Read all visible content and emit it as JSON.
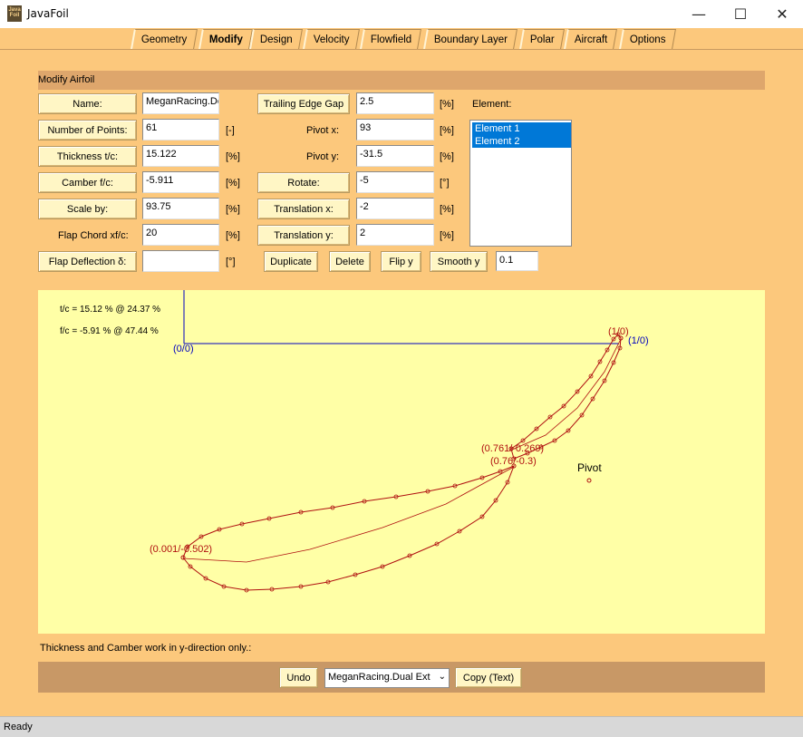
{
  "window": {
    "title": "JavaFoil",
    "icon_text": "Java Foil",
    "minimize_glyph": "—",
    "maximize_glyph": "☐",
    "close_glyph": "✕"
  },
  "tabs": [
    {
      "label": "Geometry",
      "active": false
    },
    {
      "label": "Modify",
      "active": true
    },
    {
      "label": "Design",
      "active": false
    },
    {
      "label": "Velocity",
      "active": false
    },
    {
      "label": "Flowfield",
      "active": false
    },
    {
      "label": "Boundary Layer",
      "active": false
    },
    {
      "label": "Polar",
      "active": false
    },
    {
      "label": "Aircraft",
      "active": false
    },
    {
      "label": "Options",
      "active": false
    }
  ],
  "section_title": "Modify Airfoil",
  "left_fields": {
    "name": {
      "label": "Name:",
      "value": "MeganRacing.De"
    },
    "points": {
      "label": "Number of Points:",
      "value": "61",
      "unit": "[-]"
    },
    "thickness": {
      "label": "Thickness  t/c:",
      "value": "15.122",
      "unit": "[%]"
    },
    "camber": {
      "label": "Camber  f/c:",
      "value": "-5.911",
      "unit": "[%]"
    },
    "scale": {
      "label": "Scale by:",
      "value": "93.75",
      "unit": "[%]"
    },
    "flap_chord": {
      "label": "Flap Chord    xf/c:",
      "value": "20",
      "unit": "[%]"
    },
    "flap_deflection": {
      "label": "Flap Deflection  δ:",
      "value": "",
      "unit": "[°]"
    }
  },
  "right_fields": {
    "te_gap": {
      "label": "Trailing Edge Gap",
      "value": "2.5",
      "unit": "[%]"
    },
    "pivot_x": {
      "label": "Pivot x:",
      "value": "93",
      "unit": "[%]"
    },
    "pivot_y": {
      "label": "Pivot y:",
      "value": "-31.5",
      "unit": "[%]"
    },
    "rotate": {
      "label": "Rotate:",
      "value": "-5",
      "unit": "[°]"
    },
    "translation_x": {
      "label": "Translation x:",
      "value": "-2",
      "unit": "[%]"
    },
    "translation_y": {
      "label": "Translation y:",
      "value": "2",
      "unit": "[%]"
    }
  },
  "element": {
    "label": "Element:",
    "items": [
      "Element 1",
      "Element 2"
    ]
  },
  "actions": {
    "duplicate": "Duplicate",
    "delete": "Delete",
    "flip_y": "Flip y",
    "smooth_y": "Smooth y",
    "smooth_value": "0.1"
  },
  "plot": {
    "info_line1": "t/c = 15.12 % @ 24.37 %",
    "info_line2": "f/c = -5.91 % @ 47.44 %",
    "origin_label": "(0/0)",
    "unit_label": "(1/0)",
    "label_elem2_te": "(1/0)",
    "label_elem2_le": "(0.761/-0.269)",
    "label_elem1_te": "(0.76/-0.3)",
    "label_elem1_le": "(0.001/-0.502)",
    "pivot_label": "Pivot",
    "axis_color": "#0000c0",
    "airfoil_color": "#b01010"
  },
  "note": "Thickness and Camber work in y-direction only.:",
  "bottom": {
    "undo": "Undo",
    "airfoil_select": "MeganRacing.Dual Ext",
    "copy_text": "Copy (Text)"
  },
  "status": "Ready"
}
